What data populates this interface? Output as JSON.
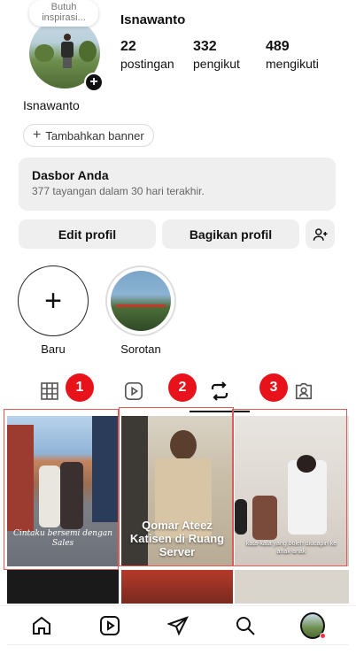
{
  "profile": {
    "username": "Isnawanto",
    "display_name": "Isnawanto",
    "note": "Butuh inspirasi...",
    "stats": [
      {
        "value": "22",
        "label": "postingan"
      },
      {
        "value": "332",
        "label": "pengikut"
      },
      {
        "value": "489",
        "label": "mengikuti"
      }
    ]
  },
  "banner": {
    "label": "Tambahkan banner"
  },
  "dashboard": {
    "title": "Dasbor Anda",
    "subtitle": "377 tayangan dalam 30 hari terakhir."
  },
  "actions": {
    "edit": "Edit profil",
    "share": "Bagikan profil"
  },
  "highlights": [
    {
      "label": "Baru"
    },
    {
      "label": "Sorotan"
    }
  ],
  "tabs": {
    "active": "reposts"
  },
  "markers": [
    "1",
    "2",
    "3"
  ],
  "posts": [
    {
      "caption": "Cintaku bersemi dengan Sales"
    },
    {
      "caption": "Qomar Ateez Katisen di Ruang Server"
    },
    {
      "caption": "kata-kata yang boleh diucapin ke anak-anak"
    }
  ],
  "colors": {
    "accent": "#e8121b",
    "notification": "#ff3040"
  }
}
